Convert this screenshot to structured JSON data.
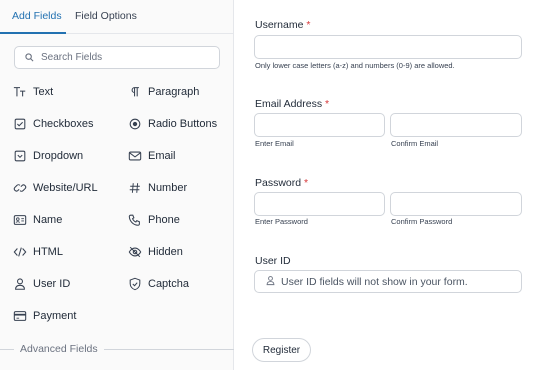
{
  "tabs": {
    "add_fields": "Add Fields",
    "field_options": "Field Options"
  },
  "search": {
    "placeholder": "Search Fields"
  },
  "fields_col1": [
    {
      "label": "Text",
      "icon": "text-icon"
    },
    {
      "label": "Checkboxes",
      "icon": "checkbox-icon"
    },
    {
      "label": "Dropdown",
      "icon": "dropdown-icon"
    },
    {
      "label": "Website/URL",
      "icon": "link-icon"
    },
    {
      "label": "Name",
      "icon": "id-card-icon"
    },
    {
      "label": "HTML",
      "icon": "code-icon"
    },
    {
      "label": "User ID",
      "icon": "user-icon"
    },
    {
      "label": "Payment",
      "icon": "credit-card-icon"
    }
  ],
  "fields_col2": [
    {
      "label": "Paragraph",
      "icon": "paragraph-icon"
    },
    {
      "label": "Radio Buttons",
      "icon": "radio-icon"
    },
    {
      "label": "Email",
      "icon": "envelope-icon"
    },
    {
      "label": "Number",
      "icon": "hash-icon"
    },
    {
      "label": "Phone",
      "icon": "phone-icon"
    },
    {
      "label": "Hidden",
      "icon": "eye-off-icon"
    },
    {
      "label": "Captcha",
      "icon": "shield-check-icon"
    }
  ],
  "advanced": {
    "label": "Advanced Fields"
  },
  "form": {
    "username": {
      "label": "Username",
      "required": "*",
      "hint": "Only lower case letters (a-z) and numbers (0-9) are allowed."
    },
    "email": {
      "label": "Email Address",
      "required": "*",
      "hint_enter": "Enter Email",
      "hint_confirm": "Confirm Email"
    },
    "password": {
      "label": "Password",
      "required": "*",
      "hint_enter": "Enter Password",
      "hint_confirm": "Confirm Password"
    },
    "user_id": {
      "label": "User ID",
      "placeholder": "User ID fields will not show in your form."
    },
    "register": "Register"
  },
  "colors": {
    "accent": "#2271b1",
    "required": "#d63638"
  }
}
